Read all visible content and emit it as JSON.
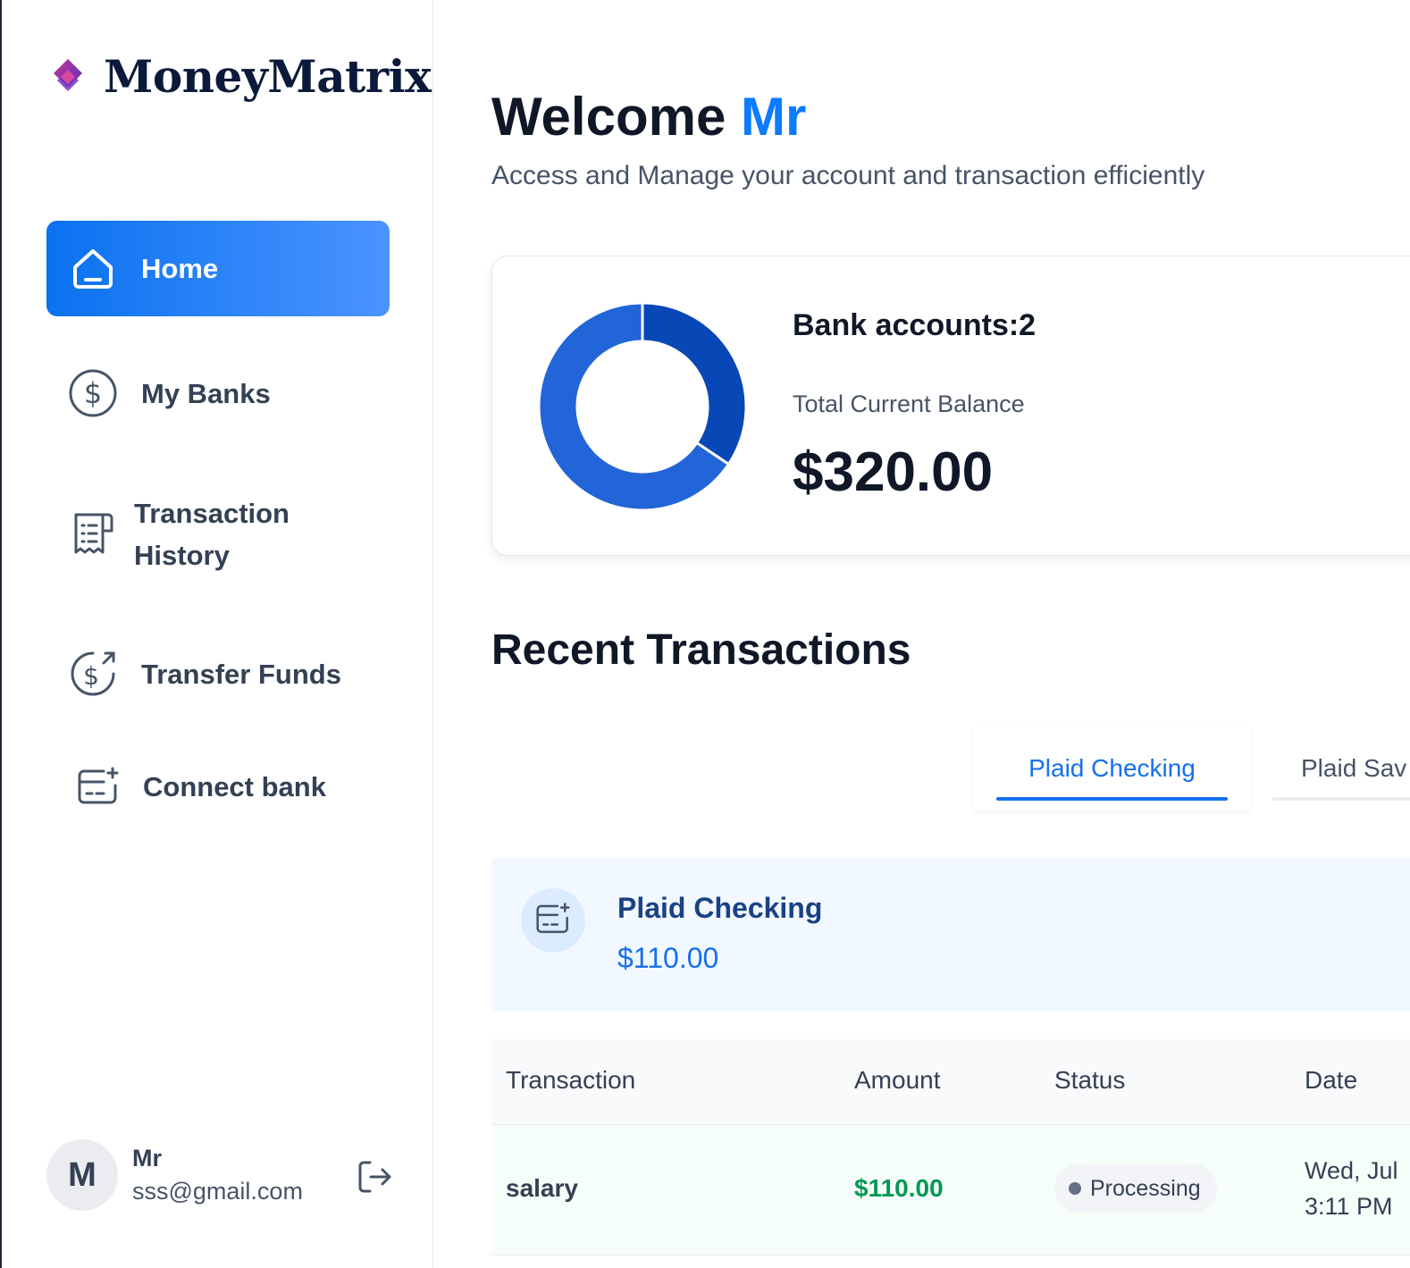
{
  "app": {
    "name": "MoneyMatrix"
  },
  "sidebar": {
    "items": [
      {
        "label": "Home",
        "icon": "home-icon",
        "active": true
      },
      {
        "label": "My Banks",
        "icon": "dollar-circle-icon",
        "active": false
      },
      {
        "label_line1": "Transaction",
        "label_line2": "History",
        "icon": "receipt-icon",
        "active": false
      },
      {
        "label": "Transfer Funds",
        "icon": "money-send-icon",
        "active": false
      },
      {
        "label": "Connect bank",
        "icon": "connect-bank-icon",
        "active": false
      }
    ],
    "user": {
      "initial": "M",
      "name": "Mr",
      "email": "sss@gmail.com"
    }
  },
  "header": {
    "welcome": "Welcome",
    "user_name": "Mr",
    "subtitle": "Access and Manage your account and transaction efficiently"
  },
  "balance": {
    "bank_accounts_label": "Bank accounts:2",
    "total_label": "Total Current Balance",
    "total_value": "$320.00"
  },
  "chart_data": {
    "type": "pie",
    "categories": [
      "Plaid Checking",
      "Plaid Saving"
    ],
    "values": [
      210,
      110
    ],
    "colors": [
      "#2265d8",
      "#0747b6"
    ]
  },
  "recent": {
    "title": "Recent Transactions",
    "tabs": [
      {
        "label": "Plaid Checking",
        "active": true
      },
      {
        "label": "Plaid Sav",
        "active": false
      }
    ],
    "bank": {
      "name": "Plaid Checking",
      "balance": "$110.00"
    },
    "columns": [
      "Transaction",
      "Amount",
      "Status",
      "Date"
    ],
    "rows": [
      {
        "name": "salary",
        "amount": "$110.00",
        "status": "Processing",
        "date_line1": "Wed, Jul",
        "date_line2": "3:11 PM"
      }
    ]
  },
  "colors": {
    "accent": "#0b7bff",
    "active_nav_start": "#0a72f0",
    "active_nav_end": "#4b93ff",
    "positive": "#039855"
  }
}
